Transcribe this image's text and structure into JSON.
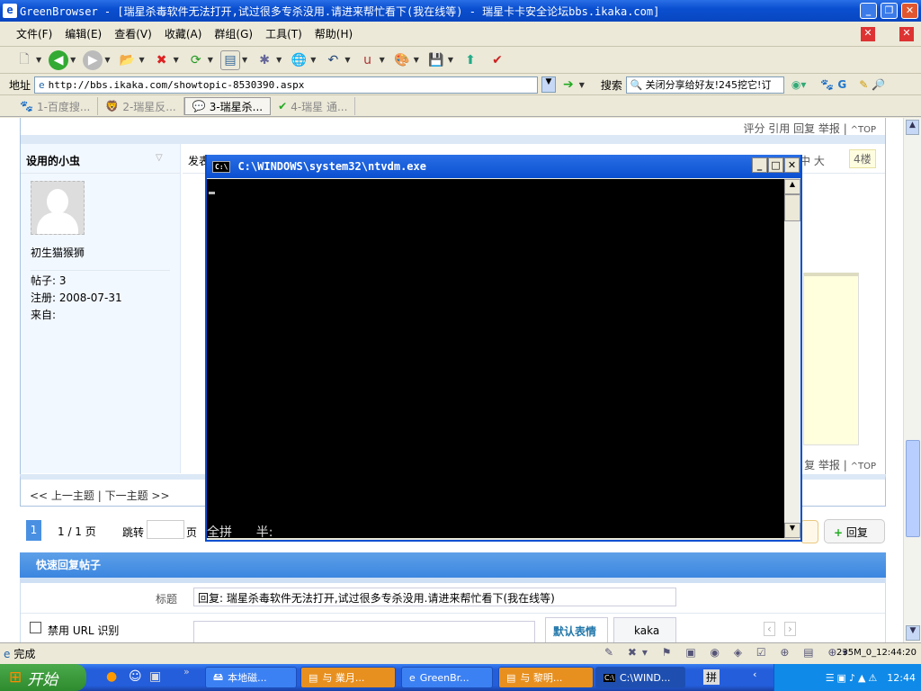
{
  "window": {
    "title": "GreenBrowser - [瑞星杀毒软件无法打开,试过很多专杀没用.请进来帮忙看下(我在线等) - 瑞星卡卡安全论坛bbs.ikaka.com]"
  },
  "menu": [
    "文件(F)",
    "编辑(E)",
    "查看(V)",
    "收藏(A)",
    "群组(G)",
    "工具(T)",
    "帮助(H)"
  ],
  "address": {
    "label": "地址",
    "url": "http://bbs.ikaka.com/showtopic-8530390.aspx",
    "search_label": "搜索",
    "search_value": "关闭分享给好友!245挖它!订"
  },
  "tabs": [
    {
      "label": "1-百度搜..."
    },
    {
      "label": "2-瑞星反..."
    },
    {
      "label": "3-瑞星杀..."
    },
    {
      "label": "4-瑞星 通..."
    }
  ],
  "post": {
    "top_actions": "评分 引用 回复 举报 |",
    "top_link": "TOP",
    "username": "设用的小虫",
    "posted_prefix": "发表",
    "font_sizes": "中  大",
    "floor": "4楼",
    "rank": "初生猫猴狮",
    "posts": "帖子: 3",
    "registered": "注册: 2008-07-31",
    "from": "来自:",
    "bottom_actions": "复 举报 |"
  },
  "nav": {
    "prev_next": "<< 上一主题 | 下一主题 >>",
    "page_current": "1",
    "page_info": "1 / 1 页",
    "jump_label": "跳转",
    "page_suffix": "页",
    "reply_button": "回复"
  },
  "quick_reply": {
    "header": "快速回复帖子",
    "title_label": "标题",
    "title_value": "回复: 瑞星杀毒软件无法打开,试过很多专杀没用.请进来帮忙看下(我在线等)",
    "disable_url": "禁用 URL 识别",
    "emoticon_tab": "默认表情",
    "kaka_tab": "kaka"
  },
  "console": {
    "title": "C:\\WINDOWS\\system32\\ntvdm.exe",
    "ime_text": "全拼      半:"
  },
  "status": {
    "text": "完成",
    "right": "235M_0_12:44:20"
  },
  "taskbar": {
    "start": "开始",
    "tasks": [
      "本地磁...",
      "与 業月...",
      "GreenBr...",
      "与 黎明...",
      "C:\\WIND..."
    ],
    "clock": "12:44",
    "ime": "拼"
  }
}
